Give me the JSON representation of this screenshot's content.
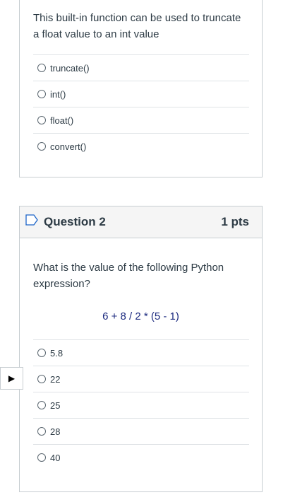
{
  "question1": {
    "text": "This built-in function can be used to truncate a float value to an int value",
    "answers": [
      "truncate()",
      "int()",
      "float()",
      "convert()"
    ]
  },
  "question2": {
    "title": "Question 2",
    "points": "1 pts",
    "text": "What is the value of the following Python expression?",
    "expression": "6 + 8 / 2 * (5 - 1)",
    "answers": [
      "5.8",
      "22",
      "25",
      "28",
      "40"
    ]
  },
  "side_toggle": {
    "icon": "play-arrow-icon",
    "glyph": "▶"
  },
  "colors": {
    "expression": "#1c2a7f",
    "border": "#c7cdd1",
    "header_bg": "#f5f5f5"
  }
}
